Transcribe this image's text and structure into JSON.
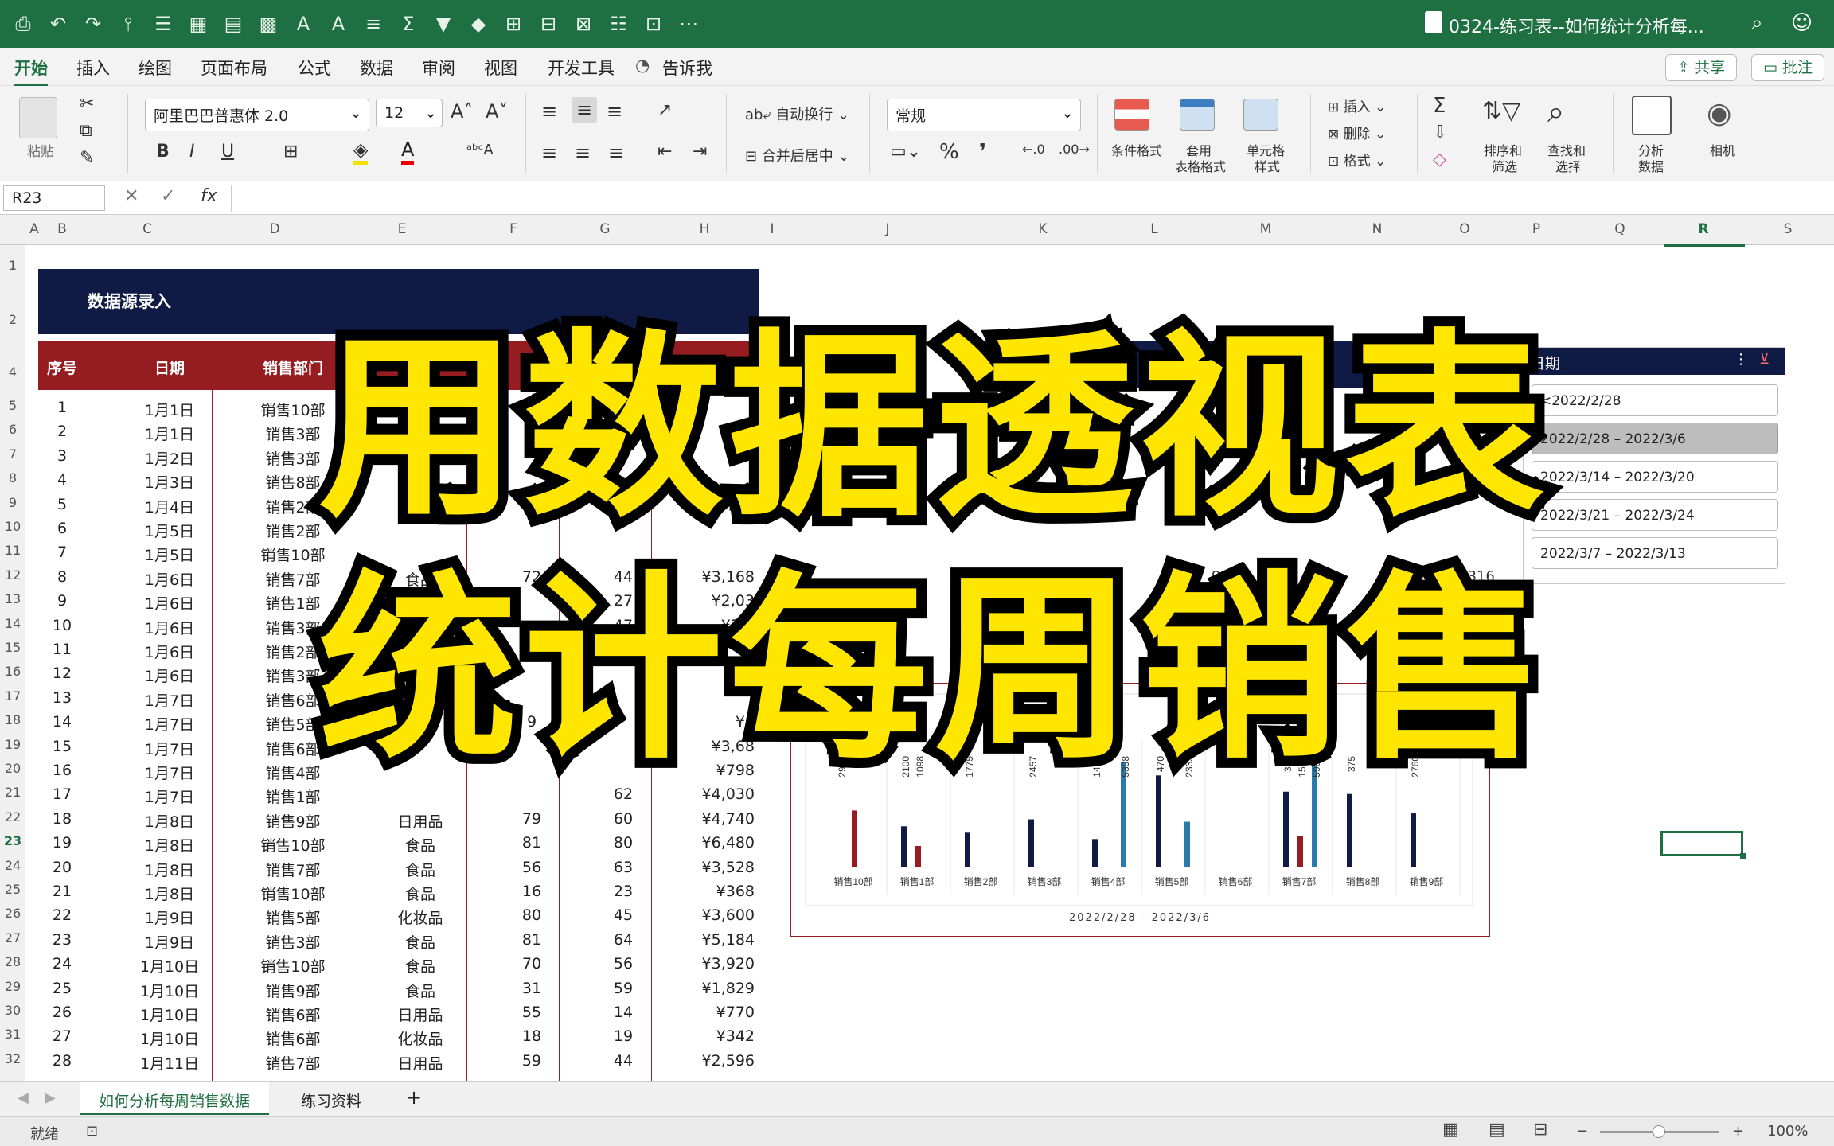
{
  "titlebar": {
    "document_title": "0324-练习表--如何统计分析每...",
    "icons": [
      "save-icon",
      "undo-icon",
      "redo-icon",
      "format-painter-icon",
      "sort-icon",
      "chart-icon",
      "table-icon",
      "font-grow-icon",
      "font-shrink-icon",
      "align-icon",
      "sum-icon",
      "filter-icon",
      "more-icon"
    ]
  },
  "menu": {
    "items": [
      "开始",
      "插入",
      "绘图",
      "页面布局",
      "公式",
      "数据",
      "审阅",
      "视图",
      "开发工具",
      "告诉我"
    ],
    "active_index": 0,
    "share_label": "共享",
    "comment_label": "批注"
  },
  "ribbon": {
    "paste_label": "粘贴",
    "font_name": "阿里巴巴普惠体 2.0",
    "font_size": "12",
    "bold": "B",
    "italic": "I",
    "underline": "U",
    "wrap_label": "自动换行",
    "merge_label": "合并后居中",
    "number_format": "常规",
    "percent": "%",
    "conditional_label": "条件格式",
    "table_format_label_1": "套用",
    "table_format_label_2": "表格格式",
    "cell_style_label_1": "单元格",
    "cell_style_label_2": "样式",
    "insert_label": "插入",
    "delete_label": "删除",
    "format_label": "格式",
    "sort_label_1": "排序和",
    "sort_label_2": "筛选",
    "find_label_1": "查找和",
    "find_label_2": "选择",
    "analyze_label_1": "分析",
    "analyze_label_2": "数据",
    "camera_label": "相机"
  },
  "formula_bar": {
    "name_box": "R23",
    "fx": "fx",
    "value": ""
  },
  "columns": [
    "A",
    "B",
    "C",
    "D",
    "E",
    "F",
    "G",
    "H",
    "I",
    "J",
    "K",
    "L",
    "M",
    "N",
    "O",
    "P",
    "Q",
    "R",
    "S"
  ],
  "selected_column": "R",
  "rows": [
    "1",
    "2",
    "4",
    "5",
    "6",
    "7",
    "8",
    "9",
    "10",
    "11",
    "12",
    "13",
    "14",
    "15",
    "16",
    "17",
    "18",
    "19",
    "20",
    "21",
    "22",
    "23",
    "24",
    "25",
    "26",
    "27",
    "28",
    "29",
    "30",
    "31",
    "32"
  ],
  "selected_row": "23",
  "banner_title": "数据源录入",
  "table": {
    "headers": [
      "序号",
      "日期",
      "销售部门",
      "",
      "数",
      "",
      "金额"
    ],
    "rows": [
      [
        "1",
        "1月1日",
        "销售10部",
        "",
        "",
        "",
        ""
      ],
      [
        "2",
        "1月1日",
        "销售3部",
        "",
        "",
        "",
        ""
      ],
      [
        "3",
        "1月2日",
        "销售3部",
        "",
        "",
        "",
        ""
      ],
      [
        "4",
        "1月3日",
        "销售8部",
        "",
        "",
        "",
        ""
      ],
      [
        "5",
        "1月4日",
        "销售2部",
        "",
        "",
        "",
        ""
      ],
      [
        "6",
        "1月5日",
        "销售2部",
        "",
        "",
        "",
        ""
      ],
      [
        "7",
        "1月5日",
        "销售10部",
        "",
        "",
        "",
        ""
      ],
      [
        "8",
        "1月6日",
        "销售7部",
        "食品",
        "72",
        "44",
        "¥3,168"
      ],
      [
        "9",
        "1月6日",
        "销售1部",
        "",
        "",
        "27",
        "¥2,03"
      ],
      [
        "10",
        "1月6日",
        "销售3部",
        "",
        "",
        "47",
        "¥3,0"
      ],
      [
        "11",
        "1月6日",
        "销售2部",
        "",
        "",
        "",
        ""
      ],
      [
        "12",
        "1月6日",
        "销售3部",
        "",
        "",
        "",
        ""
      ],
      [
        "13",
        "1月7日",
        "销售6部",
        "",
        "",
        "",
        ""
      ],
      [
        "14",
        "1月7日",
        "销售5部",
        "",
        "9",
        "",
        "¥8"
      ],
      [
        "15",
        "1月7日",
        "销售6部",
        "",
        "",
        "",
        "¥3,68"
      ],
      [
        "16",
        "1月7日",
        "销售4部",
        "",
        "",
        "",
        "¥798"
      ],
      [
        "17",
        "1月7日",
        "销售1部",
        "",
        "",
        "62",
        "¥4,030"
      ],
      [
        "18",
        "1月8日",
        "销售9部",
        "日用品",
        "79",
        "60",
        "¥4,740"
      ],
      [
        "19",
        "1月8日",
        "销售10部",
        "食品",
        "81",
        "80",
        "¥6,480"
      ],
      [
        "20",
        "1月8日",
        "销售7部",
        "食品",
        "56",
        "63",
        "¥3,528"
      ],
      [
        "21",
        "1月8日",
        "销售10部",
        "食品",
        "16",
        "23",
        "¥368"
      ],
      [
        "22",
        "1月9日",
        "销售5部",
        "化妆品",
        "80",
        "45",
        "¥3,600"
      ],
      [
        "23",
        "1月9日",
        "销售3部",
        "食品",
        "81",
        "64",
        "¥5,184"
      ],
      [
        "24",
        "1月10日",
        "销售10部",
        "食品",
        "70",
        "56",
        "¥3,920"
      ],
      [
        "25",
        "1月10日",
        "销售9部",
        "食品",
        "31",
        "59",
        "¥1,829"
      ],
      [
        "26",
        "1月10日",
        "销售6部",
        "日用品",
        "55",
        "14",
        "¥770"
      ],
      [
        "27",
        "1月10日",
        "销售6部",
        "化妆品",
        "18",
        "19",
        "¥342"
      ],
      [
        "28",
        "1月11日",
        "销售7部",
        "日用品",
        "59",
        "44",
        "¥2,596"
      ]
    ]
  },
  "pivot_fragments": {
    "dept": "销售6部",
    "v1": "9316",
    "v2": "9316"
  },
  "chart_data": {
    "type": "bar",
    "title": "",
    "xlabel": "2022/2/28 - 2022/3/6",
    "categories": [
      "销售10部",
      "销售1部",
      "销售2部",
      "销售3部",
      "销售4部",
      "销售5部",
      "销售6部",
      "销售7部",
      "销售8部",
      "销售9部"
    ],
    "series": [
      {
        "values": [
          null,
          2100,
          1775,
          2457,
          1449,
          4700,
          null,
          3870,
          3750,
          2760
        ],
        "color": "#0f1b45"
      },
      {
        "values": [
          2908,
          1098,
          null,
          null,
          null,
          null,
          null,
          1584,
          null,
          null
        ],
        "color": "#951d21"
      },
      {
        "values": [
          null,
          null,
          null,
          null,
          5398,
          2335,
          null,
          5900,
          null,
          null
        ],
        "color": "#2a7bab"
      }
    ],
    "labels": [
      "2908",
      "2100",
      "1098",
      "1775",
      "2457",
      "1449",
      "5398",
      "470",
      "2335",
      "387",
      "1584",
      "5900",
      "375",
      "2760"
    ]
  },
  "slicer": {
    "title": "日期",
    "items": [
      "<2022/2/28",
      "2022/2/28 – 2022/3/6",
      "2022/3/14 – 2022/3/20",
      "2022/3/21 – 2022/3/24",
      "2022/3/7 – 2022/3/13"
    ],
    "selected_index": 1
  },
  "sheet_tabs": {
    "tabs": [
      "如何分析每周销售数据",
      "练习资料"
    ],
    "active_index": 0,
    "add": "+"
  },
  "status": {
    "ready": "就绪",
    "zoom": "100%",
    "minus": "−",
    "plus": "+"
  },
  "overlay": {
    "line1": "用数据透视表",
    "line2": "统计每周销售",
    "color": "#ffe600"
  }
}
